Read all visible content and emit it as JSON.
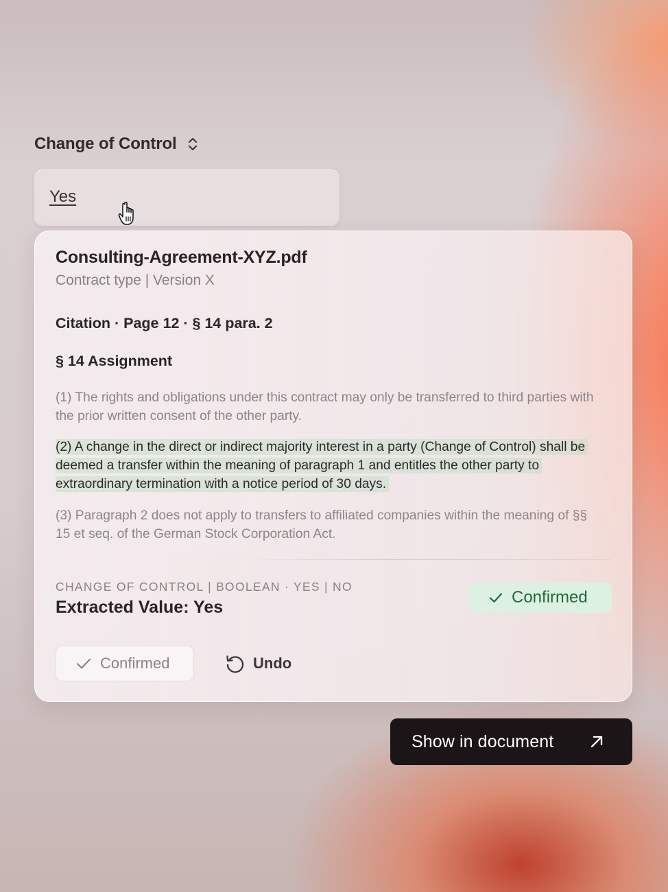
{
  "field": {
    "label": "Change of Control",
    "value": "Yes",
    "selector_icon": "chevron-up-down-icon"
  },
  "cursor_icon": "hand-pointer-cursor-icon",
  "card": {
    "file_title": "Consulting-Agreement-XYZ.pdf",
    "file_subtitle": "Contract type | Version X",
    "citation": "Citation · Page 12 · § 14 para. 2",
    "section_title": "§ 14 Assignment",
    "paragraphs": [
      "(1) The rights and obligations under this contract may only be transferred to third parties with the prior written consent of the other party.",
      "(2) A change in the direct or indirect majority interest in a party (Change of Control) shall be deemed a transfer within the meaning of paragraph 1 and entitles the other party to extraordinary termination with a notice period of 30 days.",
      "(3) Paragraph 2 does not apply to transfers to affiliated companies within the meaning of §§ 15 et seq. of the German Stock Corporation Act."
    ],
    "highlighted_paragraph_index": 1,
    "field_meta": "CHANGE OF CONTROL | BOOLEAN · YES | NO",
    "extracted_value": "Extracted Value: Yes",
    "status_badge": {
      "label": "Confirmed",
      "icon": "check-icon",
      "bg_color": "#ddf1e3",
      "text_color": "#1f6a36"
    },
    "actions": {
      "confirm_label": "Confirmed",
      "confirm_icon": "check-icon",
      "undo_label": "Undo",
      "undo_icon": "undo-icon"
    }
  },
  "show_in_document": {
    "label": "Show in document",
    "icon": "arrow-up-right-icon",
    "bg_color": "#1c1517"
  }
}
